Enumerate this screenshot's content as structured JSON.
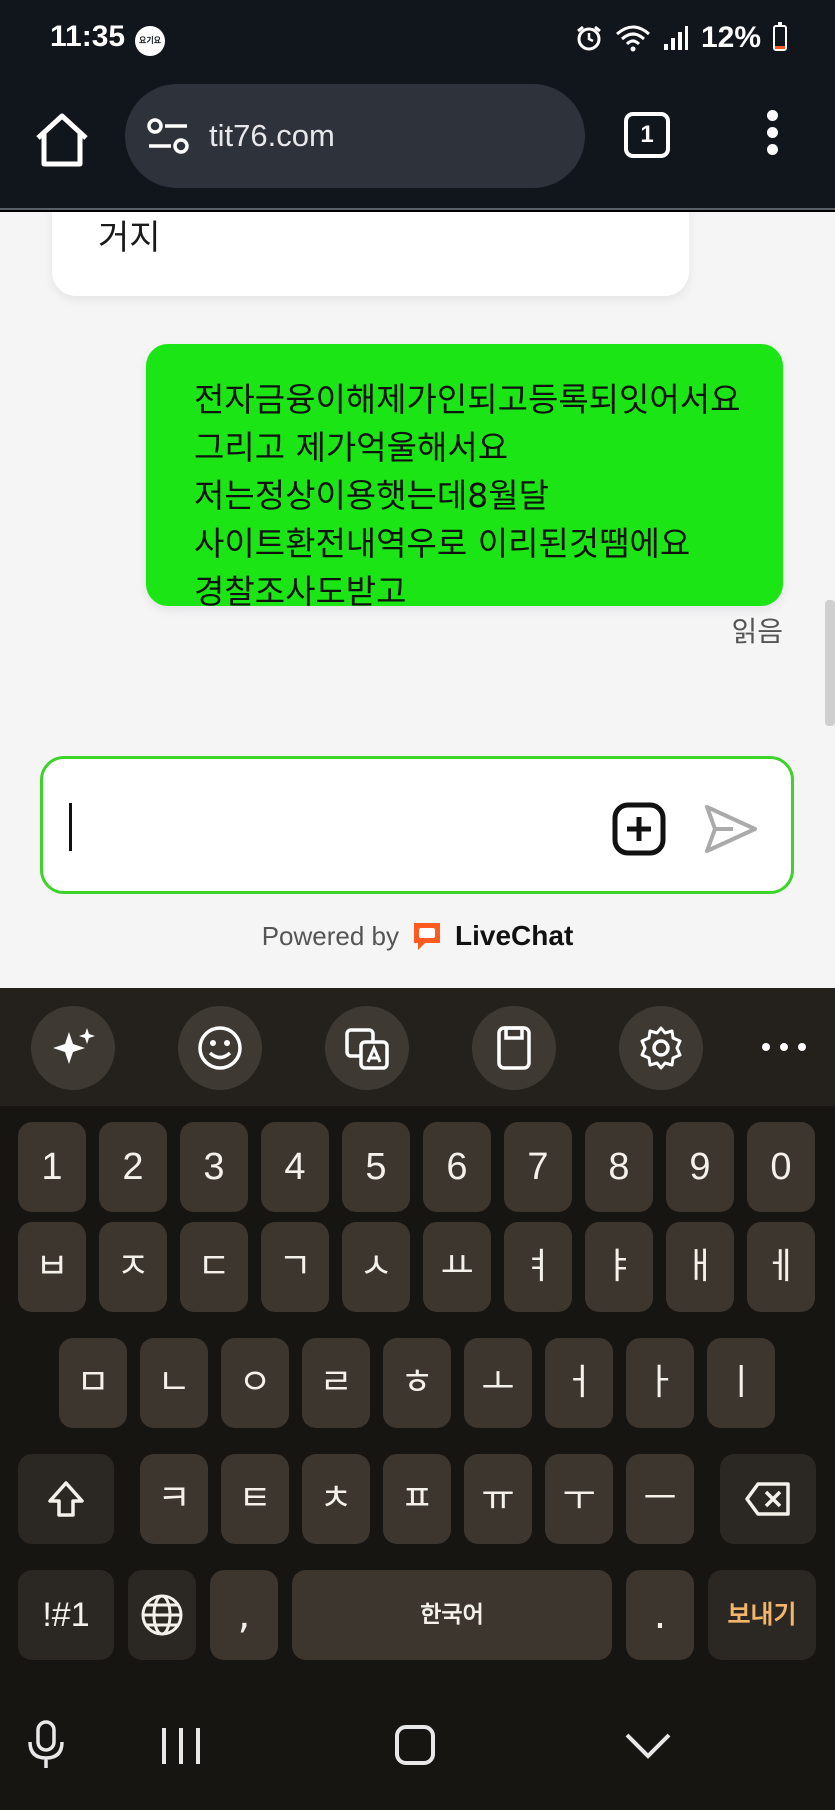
{
  "status_bar": {
    "time": "11:35",
    "app_badge": "요기요",
    "battery": "12%",
    "battery_level": 0.12
  },
  "browser": {
    "url": "tit76.com",
    "tab_count": "1"
  },
  "chat": {
    "agent_message_fragment": "거지",
    "user_message": "전자금융이해제가인되고등록되잇어서요 그리고 제가억울해서요 저는정상이용햇는데8월달 사이트환전내역우로 이리된것땜에요 경찰조사도받고",
    "read_receipt": "읽음",
    "composer_value": "",
    "powered_by": "Powered by",
    "brand": "LiveChat"
  },
  "keyboard": {
    "numbers": [
      "1",
      "2",
      "3",
      "4",
      "5",
      "6",
      "7",
      "8",
      "9",
      "0"
    ],
    "row1": [
      "ㅂ",
      "ㅈ",
      "ㄷ",
      "ㄱ",
      "ㅅ",
      "ㅛ",
      "ㅕ",
      "ㅑ",
      "ㅐ",
      "ㅔ"
    ],
    "row2": [
      "ㅁ",
      "ㄴ",
      "ㅇ",
      "ㄹ",
      "ㅎ",
      "ㅗ",
      "ㅓ",
      "ㅏ",
      "ㅣ"
    ],
    "row3": [
      "ㅋ",
      "ㅌ",
      "ㅊ",
      "ㅍ",
      "ㅠ",
      "ㅜ",
      "ㅡ"
    ],
    "symbols": "!#1",
    "comma": ",",
    "space": "한국어",
    "period": ".",
    "send": "보내기"
  },
  "colors": {
    "user_bubble": "#1be514",
    "composer_border": "#3ed32a",
    "livechat_orange": "#ff5a1f",
    "send_key_text": "#f2b56b"
  }
}
